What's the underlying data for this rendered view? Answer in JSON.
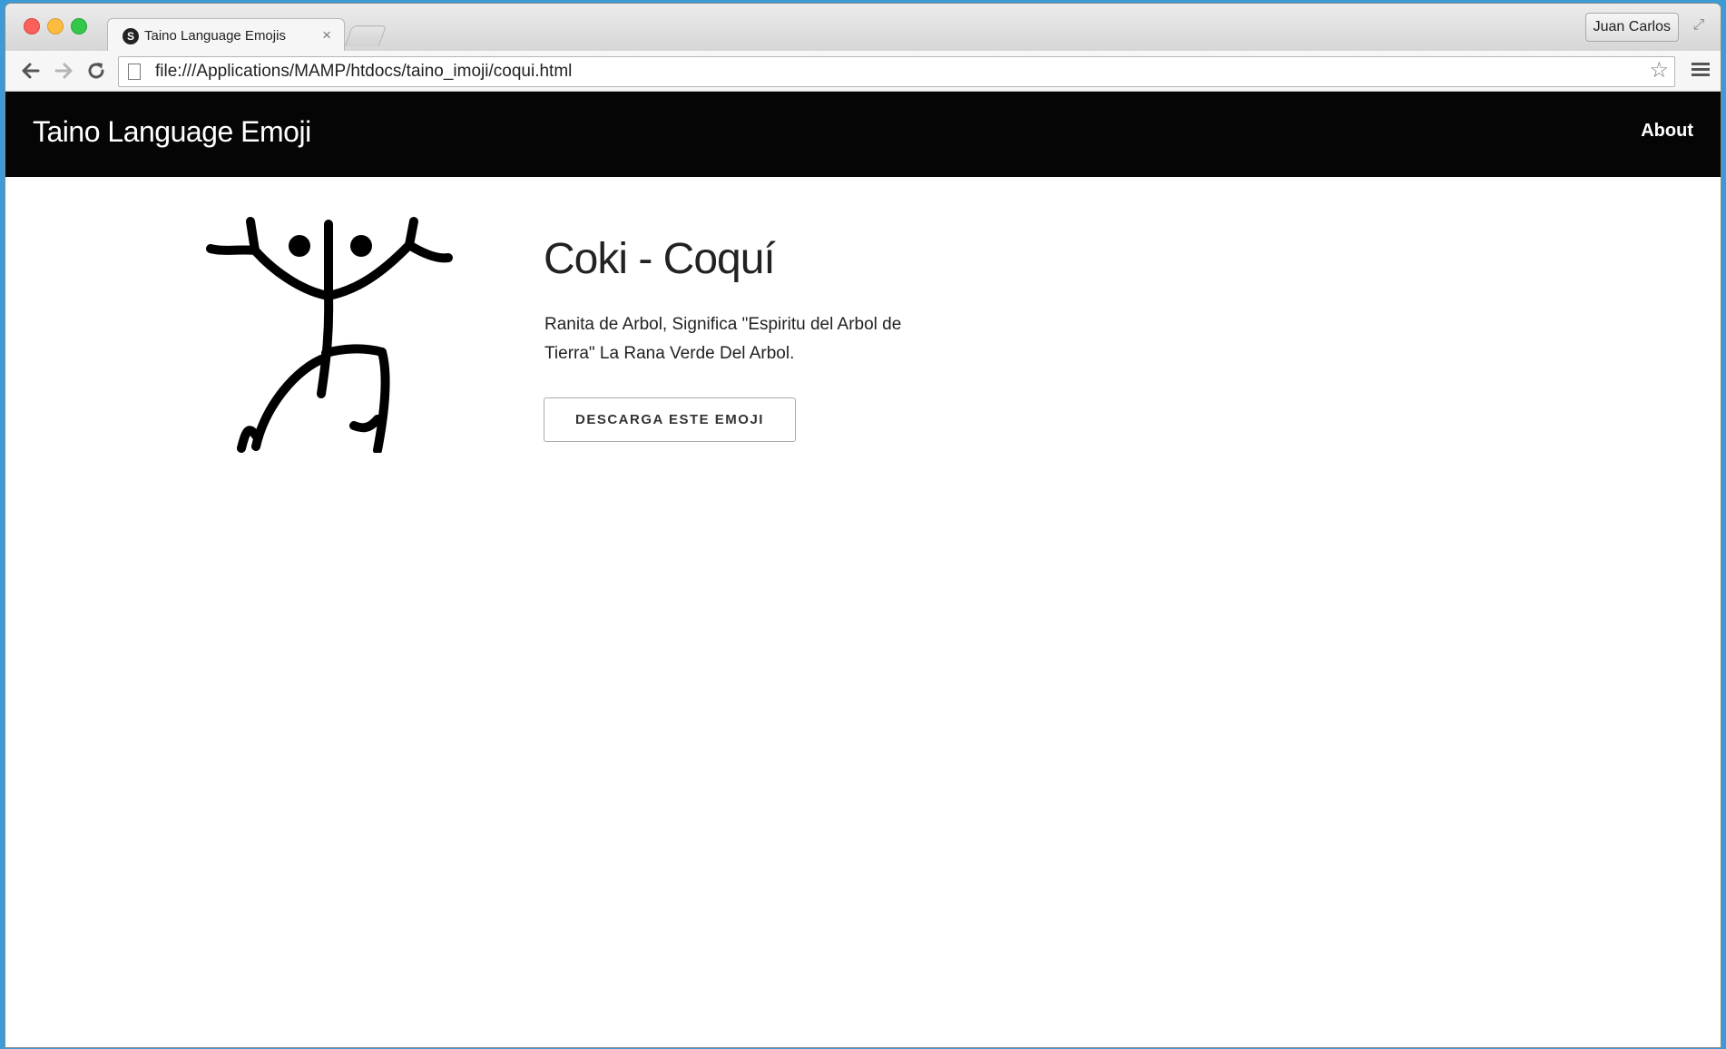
{
  "browser": {
    "tab": {
      "favicon_letter": "S",
      "title": "Taino Language Emojis",
      "close_glyph": "×"
    },
    "profile_name": "Juan Carlos",
    "url": "file:///Applications/MAMP/htdocs/taino_imoji/coqui.html",
    "icons": {
      "back": "arrow-left-icon",
      "forward": "arrow-right-icon",
      "reload": "reload-icon",
      "page": "document-icon",
      "bookmark": "star-icon",
      "menu": "hamburger-menu-icon",
      "fullscreen": "fullscreen-icon"
    }
  },
  "site": {
    "brand": "Taino Language Emoji",
    "nav": {
      "about": "About"
    },
    "navbar_color": "#050505"
  },
  "emoji": {
    "title": "Coki - Coquí",
    "description": "Ranita de Arbol, Significa \"Espiritu del Arbol de Tierra\" La Rana Verde Del Arbol.",
    "download_label": "DESCARGA ESTE EMOJI",
    "art_icon": "taino-coqui-petroglyph"
  }
}
